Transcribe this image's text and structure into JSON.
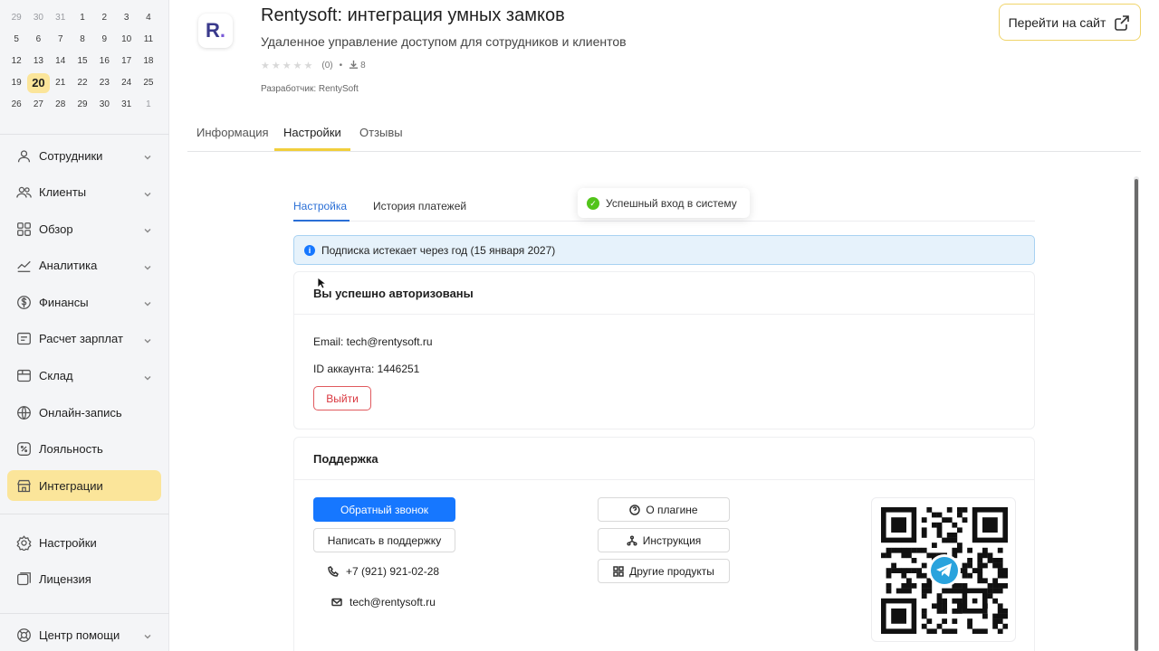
{
  "calendar": {
    "rows": [
      [
        {
          "d": "29",
          "m": true
        },
        {
          "d": "30",
          "m": true
        },
        {
          "d": "31",
          "m": true
        },
        {
          "d": "1"
        },
        {
          "d": "2"
        },
        {
          "d": "3"
        },
        {
          "d": "4"
        }
      ],
      [
        {
          "d": "5"
        },
        {
          "d": "6"
        },
        {
          "d": "7"
        },
        {
          "d": "8"
        },
        {
          "d": "9"
        },
        {
          "d": "10"
        },
        {
          "d": "11"
        }
      ],
      [
        {
          "d": "12"
        },
        {
          "d": "13"
        },
        {
          "d": "14"
        },
        {
          "d": "15"
        },
        {
          "d": "16"
        },
        {
          "d": "17"
        },
        {
          "d": "18"
        }
      ],
      [
        {
          "d": "19"
        },
        {
          "d": "20",
          "today": true
        },
        {
          "d": "21"
        },
        {
          "d": "22"
        },
        {
          "d": "23"
        },
        {
          "d": "24"
        },
        {
          "d": "25"
        }
      ],
      [
        {
          "d": "26"
        },
        {
          "d": "27"
        },
        {
          "d": "28"
        },
        {
          "d": "29"
        },
        {
          "d": "30"
        },
        {
          "d": "31"
        },
        {
          "d": "1",
          "m": true
        }
      ]
    ]
  },
  "sidebar": {
    "items": [
      {
        "label": "Сотрудники",
        "icon": "user-icon",
        "chevron": true
      },
      {
        "label": "Клиенты",
        "icon": "users-icon",
        "chevron": true
      },
      {
        "label": "Обзор",
        "icon": "grid-icon",
        "chevron": true
      },
      {
        "label": "Аналитика",
        "icon": "analytics-icon",
        "chevron": true
      },
      {
        "label": "Финансы",
        "icon": "dollar-icon",
        "chevron": true
      },
      {
        "label": "Расчет зарплат",
        "icon": "payroll-icon",
        "chevron": true
      },
      {
        "label": "Склад",
        "icon": "box-icon",
        "chevron": true
      },
      {
        "label": "Онлайн-запись",
        "icon": "globe-icon",
        "chevron": false
      },
      {
        "label": "Лояльность",
        "icon": "percent-icon",
        "chevron": false
      },
      {
        "label": "Интеграции",
        "icon": "store-icon",
        "chevron": false,
        "active": true
      }
    ],
    "bottom_items": [
      {
        "label": "Настройки",
        "icon": "gear-icon"
      },
      {
        "label": "Лицензия",
        "icon": "license-icon"
      }
    ],
    "help": {
      "label": "Центр помощи",
      "icon": "lifebuoy-icon"
    }
  },
  "app": {
    "logo": "R",
    "title": "Rentysoft: интеграция умных замков",
    "subtitle": "Удаленное управление доступом для сотрудников и клиентов",
    "rating_count": "(0)",
    "downloads": "8",
    "developer": "Разработчик: RentySoft",
    "site_button": "Перейти на сайт"
  },
  "tabs": [
    "Информация",
    "Настройки",
    "Отзывы"
  ],
  "subtabs": [
    "Настройка",
    "История платежей"
  ],
  "toast": "Успешный вход в систему",
  "info_bar": "Подписка истекает через год (15 января 2027)",
  "auth_card": {
    "title": "Вы успешно авторизованы",
    "email": "Email: tech@rentysoft.ru",
    "account_id": "ID аккаунта: 1446251",
    "logout": "Выйти"
  },
  "support_card": {
    "title": "Поддержка",
    "callback": "Обратный звонок",
    "write_support": "Написать в поддержку",
    "phone": "+7 (921) 921-02-28",
    "email": "tech@rentysoft.ru",
    "about": "О плагине",
    "instruction": "Инструкция",
    "other_products": "Другие продукты"
  },
  "colors": {
    "accent_yellow": "#fbe59a",
    "primary_blue": "#1677ff",
    "telegram": "#2aa3dd"
  }
}
